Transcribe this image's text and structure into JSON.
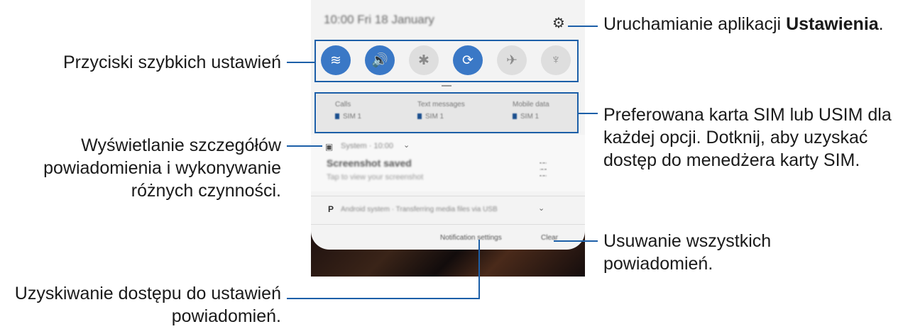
{
  "annotations": {
    "settings_prefix": "Uruchamianie aplikacji ",
    "settings_bold": "Ustawienia",
    "settings_suffix": ".",
    "quick_settings": "Przyciski szybkich ustawień",
    "sim_line1": "Preferowana karta SIM lub USIM dla",
    "sim_line2": "każdej opcji. Dotknij, aby uzyskać",
    "sim_line3": "dostęp do menedżera karty SIM.",
    "details_line1": "Wyświetlanie szczegółów",
    "details_line2": "powiadomienia i wykonywanie",
    "details_line3": "różnych czynności.",
    "clear_line1": "Usuwanie wszystkich",
    "clear_line2": "powiadomień.",
    "notif_settings_line1": "Uzyskiwanie dostępu do ustawień",
    "notif_settings_line2": "powiadomień."
  },
  "phone": {
    "status_bar": "10:00  Fri 18 January",
    "quick_settings": [
      {
        "icon": "wifi-icon",
        "glyph": "≋",
        "state": "on"
      },
      {
        "icon": "sound-icon",
        "glyph": "🔊",
        "state": "on"
      },
      {
        "icon": "bluetooth-icon",
        "glyph": "✱",
        "state": "off"
      },
      {
        "icon": "auto-rotate-icon",
        "glyph": "⟳",
        "state": "on"
      },
      {
        "icon": "airplane-icon",
        "glyph": "✈",
        "state": "off"
      },
      {
        "icon": "flashlight-icon",
        "glyph": "♆",
        "state": "off"
      }
    ],
    "sim_options": [
      {
        "label": "Calls",
        "sim": "SIM 1"
      },
      {
        "label": "Text messages",
        "sim": "SIM 1"
      },
      {
        "label": "Mobile data",
        "sim": "SIM 1"
      }
    ],
    "notification": {
      "app": "System · 10:00",
      "title": "Screenshot saved",
      "body": "Tap to view your screenshot"
    },
    "notification2": {
      "text": "Android system · Transferring media files via USB"
    },
    "footer": {
      "settings_label": "Notification settings",
      "clear_label": "Clear"
    }
  },
  "colors": {
    "accent": "#1c5fa8",
    "toggle_on": "#3a78c6",
    "toggle_off": "#dedede"
  }
}
